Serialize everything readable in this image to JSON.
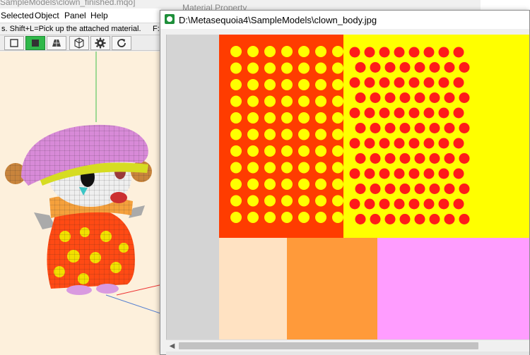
{
  "app": {
    "title": "SampleModels\\clown_finished.mqo]",
    "menu": [
      {
        "label": "Selected"
      },
      {
        "label": "Object"
      },
      {
        "label": "Panel"
      },
      {
        "label": "Help"
      }
    ],
    "status_hint": "s. Shift+L=Pick up the attached material.",
    "status_right": "F:",
    "toolbar_icons": [
      "object-icon",
      "material-icon",
      "face-icon",
      "cube-icon",
      "gear-icon",
      "refresh-icon"
    ],
    "active_toolbar_index": 1,
    "accent_green": "#2fb84a"
  },
  "background_window": {
    "title": "Material Property"
  },
  "image_window": {
    "title": "D:\\Metasequoia4\\SampleModels\\clown_body.jpg",
    "icon": "image-viewer-icon"
  },
  "texture": {
    "colors": {
      "red": "#ff3c00",
      "yellow": "#ffff00",
      "dot_red": "#ff1a1a",
      "peach": "#ffe2c2",
      "orange": "#ff9a3a",
      "pink": "#ff9dff",
      "gray": "#d4d4d4"
    }
  }
}
